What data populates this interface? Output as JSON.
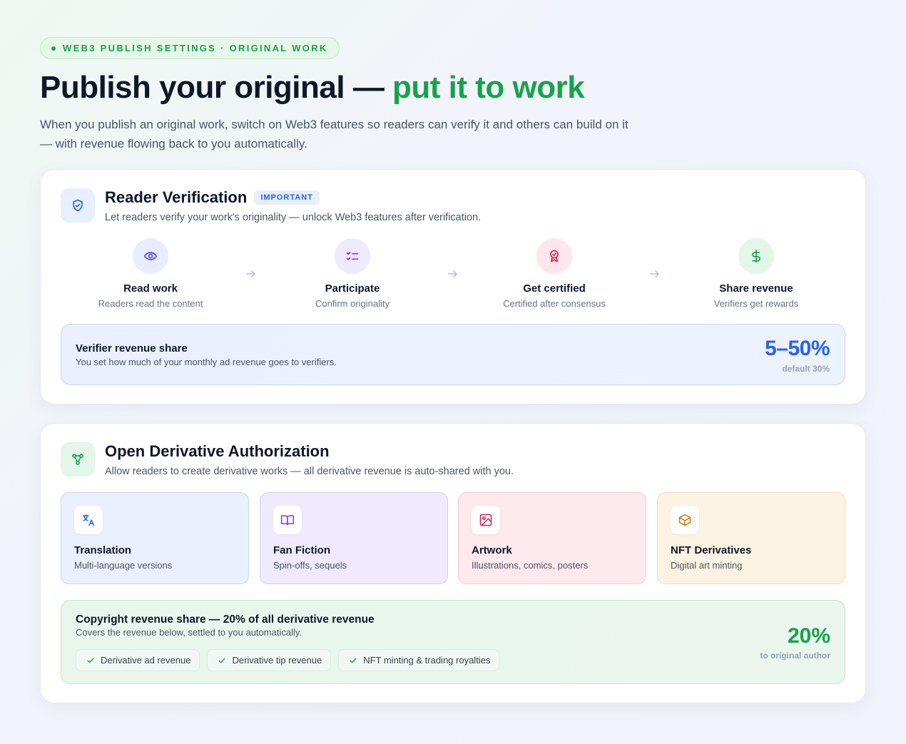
{
  "eyebrow": "WEB3 PUBLISH SETTINGS · ORIGINAL WORK",
  "title": {
    "main": "Publish your original — ",
    "accent": "put it to work"
  },
  "intro": "When you publish an original work, switch on Web3 features so readers can verify it and others can build on it — with revenue flowing back to you automatically.",
  "verification": {
    "icon": "shield-check-icon",
    "title": "Reader Verification",
    "badge": "IMPORTANT",
    "subtitle": "Let readers verify your work's originality — unlock Web3 features after verification.",
    "steps": [
      {
        "icon": "eye-icon",
        "title": "Read work",
        "subtitle": "Readers read the content",
        "color": "#4f46e5",
        "bg": "#e9edff"
      },
      {
        "icon": "checklist-icon",
        "title": "Participate",
        "subtitle": "Confirm originality",
        "color": "#7c3aed",
        "bg": "#efeaff"
      },
      {
        "icon": "award-icon",
        "title": "Get certified",
        "subtitle": "Certified after consensus",
        "color": "#e11d48",
        "bg": "#fde7ec"
      },
      {
        "icon": "dollar-icon",
        "title": "Share revenue",
        "subtitle": "Verifiers get rewards",
        "color": "#16a34a",
        "bg": "#e3f6e9"
      }
    ],
    "revenue": {
      "title": "Verifier revenue share",
      "subtitle": "You set how much of your monthly ad revenue goes to verifiers.",
      "value": "5–50%",
      "note": "default 30%"
    }
  },
  "derivative": {
    "icon": "share-nodes-icon",
    "title": "Open Derivative Authorization",
    "subtitle": "Allow readers to create derivative works — all derivative revenue is auto-shared with you.",
    "types": [
      {
        "icon": "translate-icon",
        "title": "Translation",
        "subtitle": "Multi-language versions",
        "bg": "#eaf0fd",
        "border": "#c9d6f5",
        "color": "#2563eb"
      },
      {
        "icon": "book-icon",
        "title": "Fan Fiction",
        "subtitle": "Spin-offs, sequels",
        "bg": "#efeafd",
        "border": "#d7ccf6",
        "color": "#7c3aed"
      },
      {
        "icon": "image-icon",
        "title": "Artwork",
        "subtitle": "Illustrations, comics, posters",
        "bg": "#fde9ee",
        "border": "#f6cbd6",
        "color": "#e11d48"
      },
      {
        "icon": "cube-icon",
        "title": "NFT Derivatives",
        "subtitle": "Digital art minting",
        "bg": "#fdf3e2",
        "border": "#f3dcb0",
        "color": "#d97706"
      }
    ],
    "copyright": {
      "title": "Copyright revenue share — 20% of all derivative revenue",
      "subtitle": "Covers the revenue below, settled to you automatically.",
      "items": [
        "Derivative ad revenue",
        "Derivative tip revenue",
        "NFT minting & trading royalties"
      ],
      "value": "20%",
      "note": "to original author"
    }
  }
}
